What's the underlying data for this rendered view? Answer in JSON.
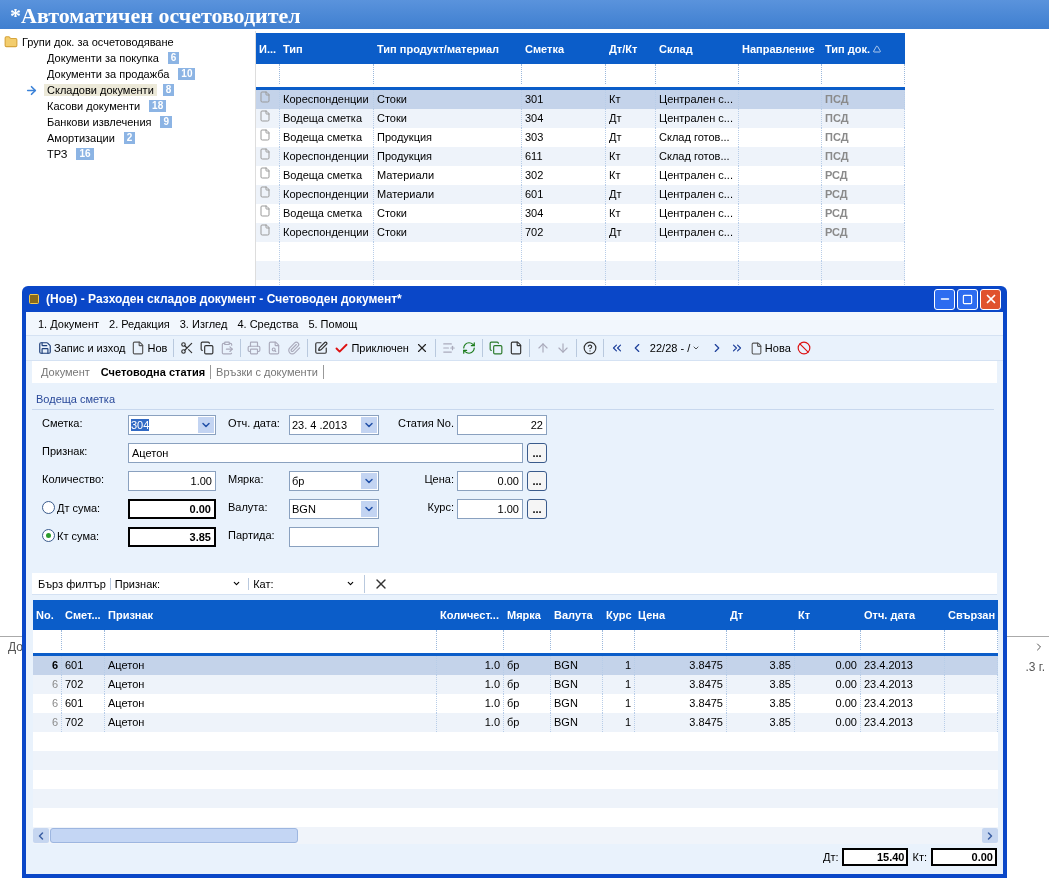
{
  "app_title": "*Автоматичен осчетоводител",
  "tree": {
    "label": "Групи док. за осчетоводяване",
    "children": [
      {
        "label": "Документи за покупка",
        "count": "6",
        "selected": false
      },
      {
        "label": "Документи за продажба",
        "count": "10",
        "selected": false
      },
      {
        "label": "Складови документи",
        "count": "8",
        "selected": true
      },
      {
        "label": "Касови документи",
        "count": "18",
        "selected": false
      },
      {
        "label": "Банкови извлечения",
        "count": "9",
        "selected": false
      },
      {
        "label": "Амортизации",
        "count": "2",
        "selected": false
      },
      {
        "label": "ТРЗ",
        "count": "16",
        "selected": false
      }
    ]
  },
  "rules_table": {
    "columns": [
      "И...",
      "Тип",
      "Тип продукт/материал",
      "Сметка",
      "Дт/Кт",
      "Склад",
      "Направление",
      "Тип док."
    ],
    "rows": [
      {
        "selected": true,
        "cells": [
          "",
          "Кореспонденции",
          "Стоки",
          "301",
          "Кт",
          "Централен с...",
          "",
          "ПСД"
        ]
      },
      {
        "selected": false,
        "cells": [
          "",
          "Водеща сметка",
          "Стоки",
          "304",
          "Дт",
          "Централен с...",
          "",
          "ПСД"
        ]
      },
      {
        "selected": false,
        "cells": [
          "",
          "Водеща сметка",
          "Продукция",
          "303",
          "Дт",
          "Склад готов...",
          "",
          "ПСД"
        ]
      },
      {
        "selected": false,
        "cells": [
          "",
          "Кореспонденции",
          "Продукция",
          "611",
          "Кт",
          "Склад готов...",
          "",
          "ПСД"
        ]
      },
      {
        "selected": false,
        "cells": [
          "",
          "Водеща сметка",
          "Материали",
          "302",
          "Кт",
          "Централен с...",
          "",
          "РСД"
        ]
      },
      {
        "selected": false,
        "cells": [
          "",
          "Кореспонденции",
          "Материали",
          "601",
          "Дт",
          "Централен с...",
          "",
          "РСД"
        ]
      },
      {
        "selected": false,
        "cells": [
          "",
          "Водеща сметка",
          "Стоки",
          "304",
          "Кт",
          "Централен с...",
          "",
          "РСД"
        ]
      },
      {
        "selected": false,
        "cells": [
          "",
          "Кореспонденции",
          "Стоки",
          "702",
          "Дт",
          "Централен с...",
          "",
          "РСД"
        ]
      }
    ]
  },
  "background_fragments": {
    "left": "До",
    "right": ".3 г."
  },
  "dialog": {
    "title": "(Нов) - Разходен складов документ - Счетоводен документ*",
    "menu": [
      "1. Документ",
      "2. Редакция",
      "3. Изглед",
      "4. Средства",
      "5. Помощ"
    ],
    "toolbar": {
      "save": "Запис и изход",
      "new": "Нов",
      "close_doc": "Приключен",
      "position": "22/28 - /",
      "new_record": "Нова"
    },
    "tabs": [
      {
        "label": "Документ",
        "selected": false
      },
      {
        "label": "Счетоводна статия",
        "selected": true
      },
      {
        "label": "Връзки с документи",
        "selected": false
      }
    ],
    "form": {
      "section_label": "Водеща сметка",
      "account": {
        "label": "Сметка:",
        "value": "304"
      },
      "report_date": {
        "label": "Отч. дата:",
        "value": "23. 4 .2013"
      },
      "entry_no": {
        "label": "Статия No.",
        "value": "22"
      },
      "attribute": {
        "label": "Признак:",
        "value": "Ацетон",
        "button": "..."
      },
      "quantity": {
        "label": "Количество:",
        "value": "1.00"
      },
      "unit": {
        "label": "Мярка:",
        "value": "бр"
      },
      "price": {
        "label": "Цена:",
        "value": "0.00",
        "button": "..."
      },
      "debit_amount": {
        "label": "Дт сума:",
        "value": "0.00",
        "selected": false
      },
      "currency": {
        "label": "Валута:",
        "value": "BGN"
      },
      "rate": {
        "label": "Курс:",
        "value": "1.00",
        "button": "..."
      },
      "credit_amount": {
        "label": "Кт сума:",
        "value": "3.85",
        "selected": true
      },
      "batch": {
        "label": "Партида:"
      }
    },
    "quick_filter": {
      "label": "Бърз филтър",
      "fields": [
        {
          "label": "Признак:"
        },
        {
          "label": "Кат:"
        }
      ]
    },
    "entries": {
      "columns": [
        "No.",
        "Смет...",
        "Признак",
        "Количест...",
        "Мярка",
        "Валута",
        "Курс",
        "Цена",
        "Дт",
        "Кт",
        "Отч. дата",
        "Свързан"
      ],
      "rows": [
        {
          "selected": true,
          "cells": [
            "6",
            "601",
            "Ацетон",
            "1.0",
            "бр",
            "BGN",
            "1",
            "3.8475",
            "3.85",
            "0.00",
            "23.4.2013",
            ""
          ]
        },
        {
          "selected": false,
          "cells": [
            "6",
            "702",
            "Ацетон",
            "1.0",
            "бр",
            "BGN",
            "1",
            "3.8475",
            "3.85",
            "0.00",
            "23.4.2013",
            ""
          ]
        },
        {
          "selected": false,
          "cells": [
            "6",
            "601",
            "Ацетон",
            "1.0",
            "бр",
            "BGN",
            "1",
            "3.8475",
            "3.85",
            "0.00",
            "23.4.2013",
            ""
          ]
        },
        {
          "selected": false,
          "cells": [
            "6",
            "702",
            "Ацетон",
            "1.0",
            "бр",
            "BGN",
            "1",
            "3.8475",
            "3.85",
            "0.00",
            "23.4.2013",
            ""
          ]
        }
      ]
    },
    "totals": {
      "debit_label": "Дт:",
      "debit": "15.40",
      "credit_label": "Кт:",
      "credit": "0.00"
    }
  }
}
